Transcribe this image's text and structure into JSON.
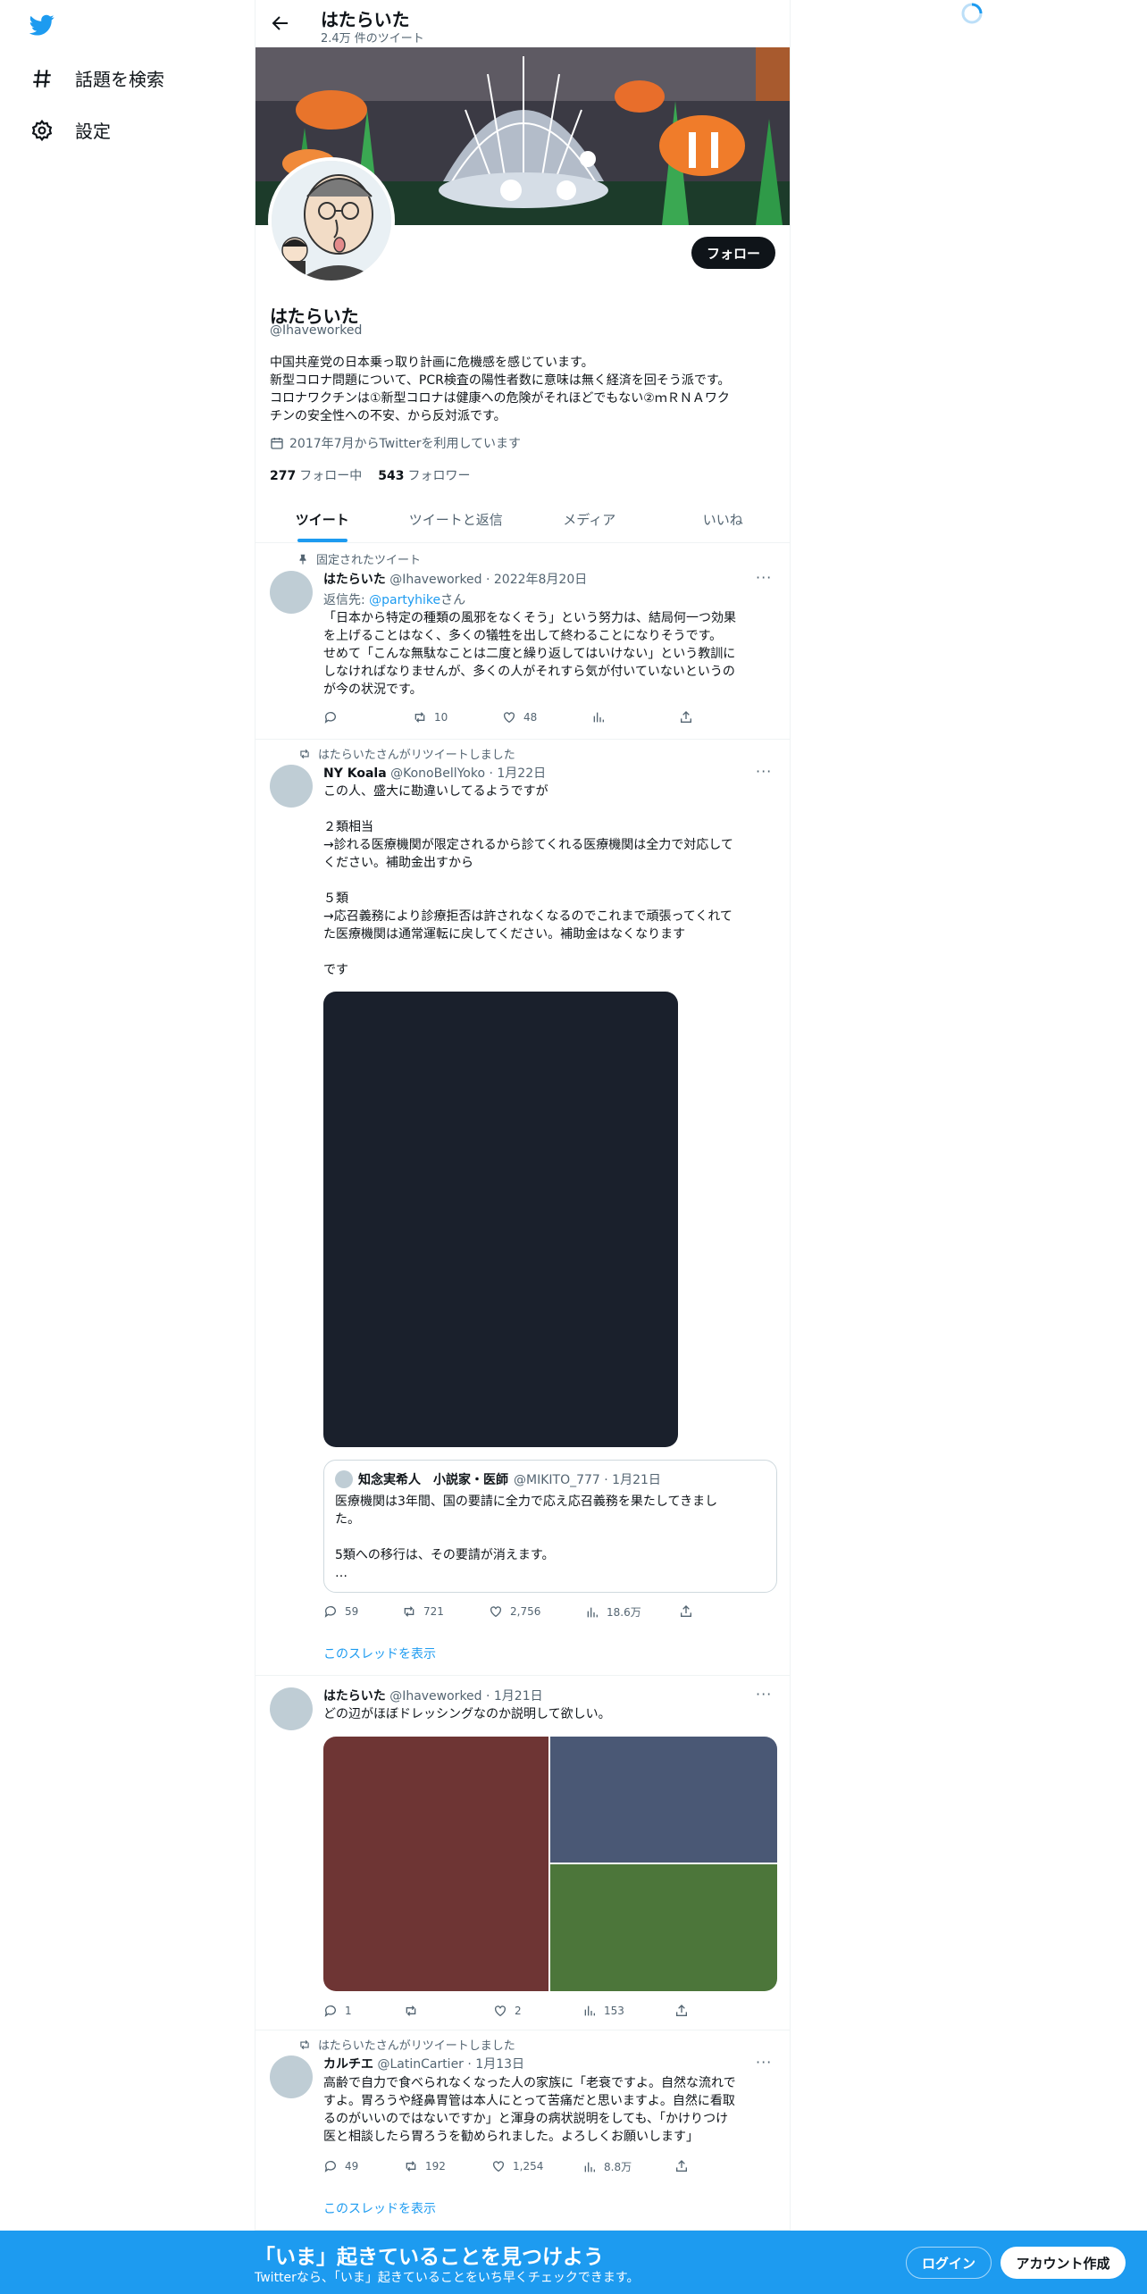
{
  "nav": {
    "explore_label": "話題を検索",
    "settings_label": "設定"
  },
  "header": {
    "title": "はたらいた",
    "tweet_count": "2.4万 件のツイート"
  },
  "profile": {
    "name": "はたらいた",
    "handle": "@Ihaveworked",
    "follow_label": "フォロー",
    "bio": [
      "中国共産党の日本乗っ取り計画に危機感を感じています。",
      "新型コロナ問題について、PCR検査の陽性者数に意味は無く経済を回そう派です。",
      "コロナワクチンは①新型コロナは健康への危険がそれほどでもない②ｍＲＮＡワク",
      "チンの安全性への不安、から反対派です。"
    ],
    "joined": "2017年7月からTwitterを利用しています",
    "following_count": "277",
    "following_label": "フォロー中",
    "followers_count": "543",
    "followers_label": "フォロワー"
  },
  "tabs": [
    "ツイート",
    "ツイートと返信",
    "メディア",
    "いいね"
  ],
  "tweets": [
    {
      "context": "固定されたツイート",
      "name": "はたらいた",
      "meta": "@Ihaveworked · 2022年8月20日",
      "reply_prefix": "返信先: ",
      "reply_to": "@partyhike",
      "reply_suffix": "さん",
      "text": [
        "「日本から特定の種類の風邪をなくそう」という努力は、結局何一つ効果",
        "を上げることはなく、多くの犠牲を出して終わることになりそうです。",
        "せめて「こんな無駄なことは二度と繰り返してはいけない」という教訓に",
        "しなければなりませんが、多くの人がそれすら気が付いていないというの",
        "が今の状況です。"
      ],
      "replies": "",
      "retweets": "10",
      "likes": "48",
      "views": ""
    },
    {
      "context": "はたらいたさんがリツイートしました",
      "name": "NY Koala",
      "meta": "@KonoBellYoko · 1月22日",
      "text": [
        "この人、盛大に勘違いしてるようですが",
        "",
        "２類相当",
        "→診れる医療機関が限定されるから診てくれる医療機関は全力で対応して",
        "ください。補助金出すから",
        "",
        "５類",
        "→応召義務により診療拒否は許されなくなるのでこれまで頑張ってくれて",
        "た医療機関は通常運転に戻してください。補助金はなくなります",
        "",
        "です"
      ],
      "quote": {
        "name": "知念実希人　小説家・医師",
        "meta": "@MIKITO_777 · 1月21日",
        "text": [
          "医療機関は3年間、国の要請に全力で応え応召義務を果たしてきまし",
          "た。",
          "",
          "5類への移行は、その要請が消えます。",
          "…"
        ]
      },
      "replies": "59",
      "retweets": "721",
      "likes": "2,756",
      "views": "18.6万",
      "thread_link": "このスレッドを表示"
    },
    {
      "name": "はたらいた",
      "meta": "@Ihaveworked · 1月21日",
      "text": [
        "どの辺がほぼドレッシングなのか説明して欲しい。"
      ],
      "replies": "1",
      "retweets": "",
      "likes": "2",
      "views": "153"
    },
    {
      "context": "はたらいたさんがリツイートしました",
      "name": "カルチエ",
      "meta": "@LatinCartier · 1月13日",
      "text": [
        "高齢で自力で食べられなくなった人の家族に「老衰ですよ。自然な流れで",
        "すよ。胃ろうや経鼻胃管は本人にとって苦痛だと思いますよ。自然に看取",
        "るのがいいのではないですか」と渾身の病状説明をしても、「かけりつけ",
        "医と相談したら胃ろうを勧められました。よろしくお願いします」"
      ],
      "replies": "49",
      "retweets": "192",
      "likes": "1,254",
      "views": "8.8万",
      "thread_link": "このスレッドを表示"
    }
  ],
  "bottom_bar": {
    "title": "「いま」起きていることを見つけよう",
    "subtitle": "Twitterなら、「いま」起きていることをいち早くチェックできます。",
    "login_label": "ログイン",
    "signup_label": "アカウント作成"
  },
  "colors": {
    "accent": "#1d9bf0",
    "text": "#0f1419",
    "muted": "#536471"
  }
}
